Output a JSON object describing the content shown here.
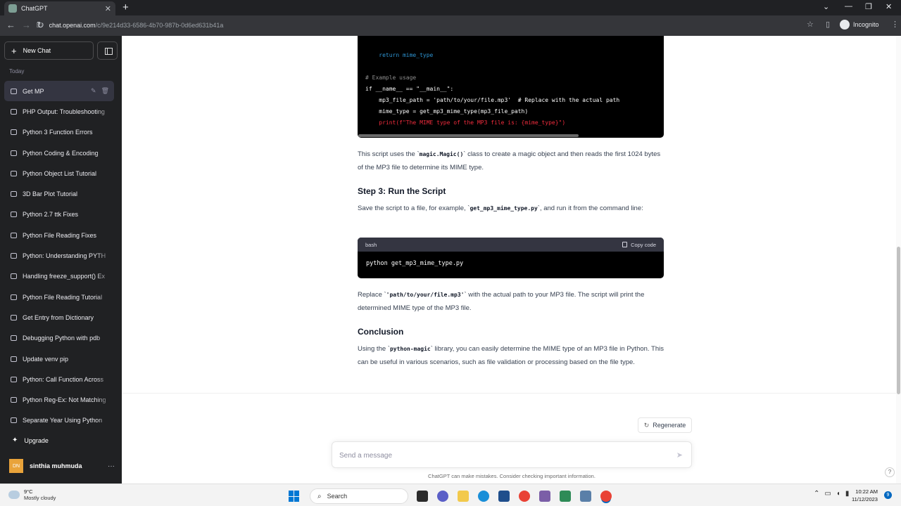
{
  "browser": {
    "tab_title": "ChatGPT",
    "url_host": "chat.openai.com",
    "url_path": "/c/9e214d33-6586-4b70-987b-0d6ed631b41a",
    "incognito_label": "Incognito"
  },
  "sidebar": {
    "new_chat_label": "New Chat",
    "section_label": "Today",
    "items": [
      {
        "label": "Get MP"
      },
      {
        "label": "PHP Output: Troubleshooting"
      },
      {
        "label": "Python 3 Function Errors"
      },
      {
        "label": "Python Coding & Encoding"
      },
      {
        "label": "Python Object List Tutorial"
      },
      {
        "label": "3D Bar Plot Tutorial"
      },
      {
        "label": "Python 2.7 ttk Fixes"
      },
      {
        "label": "Python File Reading Fixes"
      },
      {
        "label": "Python: Understanding PYTH"
      },
      {
        "label": "Handling freeze_support() Ex"
      },
      {
        "label": "Python File Reading Tutorial"
      },
      {
        "label": "Get Entry from Dictionary"
      },
      {
        "label": "Debugging Python with pdb"
      },
      {
        "label": "Update venv pip"
      },
      {
        "label": "Python: Call Function Across"
      },
      {
        "label": "Python Reg-Ex: Not Matching"
      },
      {
        "label": "Separate Year Using Python"
      }
    ],
    "upgrade_label": "Upgrade",
    "user_initials": "DN",
    "user_name": "sinthia muhmuda"
  },
  "conversation": {
    "code_top_lines": [
      "    return mime_type",
      "",
      "# Example usage",
      "if __name__ == \"__main__\":",
      "    mp3_file_path = 'path/to/your/file.mp3'  # Replace with the actual path",
      "    mime_type = get_mp3_mime_type(mp3_file_path)",
      "    print(f\"The MIME type of the MP3 file is: {mime_type}\")"
    ],
    "para1_a": "This script uses the `",
    "para1_code": "magic.Magic()",
    "para1_b": "` class to create a magic object and then reads the first 1024 bytes of the MP3 file to determine its MIME type.",
    "step3_heading": "Step 3: Run the Script",
    "para2_a": "Save the script to a file, for example, `",
    "para2_code": "get_mp3_mime_type.py",
    "para2_b": "`, and run it from the command line:",
    "bash_lang": "bash",
    "copy_code_label": "Copy code",
    "bash_code": "python get_mp3_mime_type.py",
    "para3_a": "Replace `",
    "para3_code": "'path/to/your/file.mp3'",
    "para3_b": "` with the actual path to your MP3 file. The script will print the determined MIME type of the MP3 file.",
    "conclusion_heading": "Conclusion",
    "para4_a": "Using the `",
    "para4_code": "python-magic",
    "para4_b": "` library, you can easily determine the MIME type of an MP3 file in Python. This can be useful in various scenarios, such as file validation or processing based on the file type."
  },
  "composer": {
    "regenerate_label": "Regenerate",
    "placeholder": "Send a message",
    "disclaimer": "ChatGPT can make mistakes. Consider checking important information.",
    "help_label": "?"
  },
  "taskbar": {
    "temp": "9°C",
    "weather": "Mostly cloudy",
    "search_label": "Search",
    "time": "10:22 AM",
    "date": "11/12/2023",
    "notif_count": "9"
  }
}
